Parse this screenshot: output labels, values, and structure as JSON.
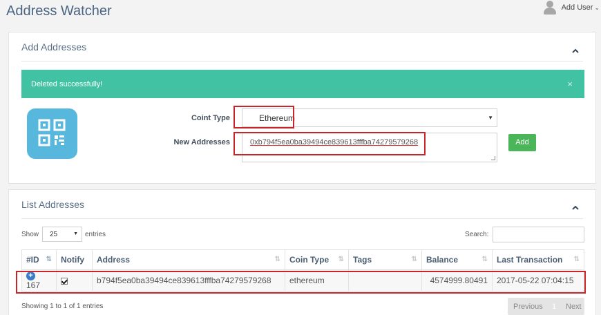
{
  "header": {
    "title": "Address Watcher",
    "user_menu": "Add User",
    "caret": "⌄"
  },
  "add_panel": {
    "title": "Add Addresses",
    "alert": {
      "message": "Deleted successfully!",
      "close": "×"
    },
    "coin_type_label": "Coint Type",
    "coin_type_value": "Ethereum",
    "new_addresses_label": "New Addresses",
    "new_addresses_value": "0xb794f5ea0ba39494ce839613fffba74279579268",
    "add_button": "Add"
  },
  "list_panel": {
    "title": "List Addresses",
    "show_label": "Show",
    "entries_label": "entries",
    "page_length": "25",
    "search_label": "Search:",
    "columns": [
      "#ID",
      "Notify",
      "Address",
      "Coin Type",
      "Tags",
      "Balance",
      "Last Transaction"
    ],
    "rows": [
      {
        "id": "167",
        "notify": true,
        "address": "b794f5ea0ba39494ce839613fffba74279579268",
        "coin_type": "ethereum",
        "tags": "",
        "balance": "4574999.80491",
        "last_transaction": "2017-05-22 07:04:15"
      }
    ],
    "info": "Showing 1 to 1 of 1 entries",
    "pagination": {
      "previous": "Previous",
      "current": "1",
      "next": "Next"
    }
  },
  "colors": {
    "alert": "#41c3a3",
    "add_button": "#4bb55a",
    "highlight": "#c9242a",
    "qr_tile": "#58b7dc"
  }
}
